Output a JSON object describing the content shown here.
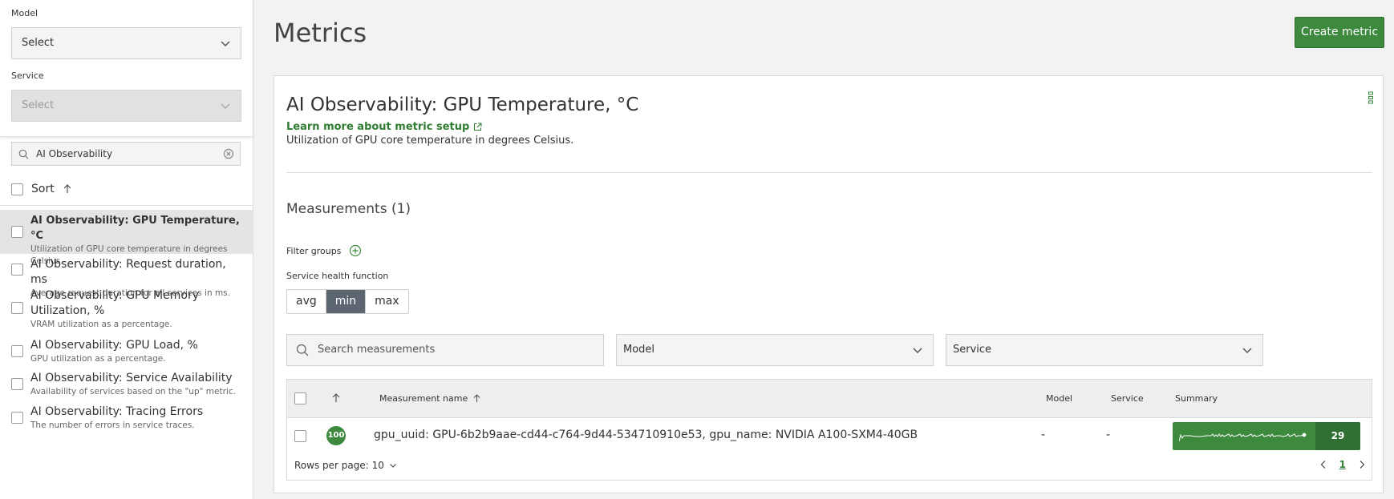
{
  "sidebar": {
    "model_label": "Model",
    "model_value": "Select",
    "service_label": "Service",
    "service_value": "Select",
    "search_value": "AI Observability",
    "sort_label": "Sort",
    "items": [
      {
        "title": "AI Observability: GPU Temperature, °C",
        "desc": "Utilization of GPU core temperature in degrees Celsius."
      },
      {
        "title": "AI Observability: Request duration, ms",
        "desc": "Average request duration for all services in ms."
      },
      {
        "title": "AI Observability: GPU Memory Utilization, %",
        "desc": "VRAM utilization as a percentage."
      },
      {
        "title": "AI Observability: GPU Load, %",
        "desc": "GPU utilization as a percentage."
      },
      {
        "title": "AI Observability: Service Availability",
        "desc": "Availability of services based on the \"up\" metric."
      },
      {
        "title": "AI Observability: Tracing Errors",
        "desc": "The number of errors in service traces."
      }
    ]
  },
  "main": {
    "title": "Metrics",
    "create_button": "Create metric",
    "card": {
      "title": "AI Observability: GPU Temperature, °C",
      "learn_more": "Learn more about metric setup",
      "description": "Utilization of GPU core temperature in degrees Celsius.",
      "measurements_title": "Measurements (1)",
      "filter_groups": "Filter groups",
      "health_function_label": "Service health function",
      "health_functions": [
        "avg",
        "min",
        "max"
      ],
      "health_function_selected": "min",
      "search_placeholder": "Search measurements",
      "model_filter": "Model",
      "service_filter": "Service",
      "table": {
        "headers": {
          "name": "Measurement name",
          "model": "Model",
          "service": "Service",
          "summary": "Summary"
        },
        "rows": [
          {
            "score": "100",
            "name": "gpu_uuid: GPU-6b2b9aae-cd44-c764-9d44-534710910e53, gpu_name: NVIDIA A100-SXM4-40GB",
            "model": "-",
            "service": "-",
            "summary_value": "29"
          }
        ],
        "rows_per_page": "Rows per page: 10",
        "page": "1"
      }
    }
  },
  "colors": {
    "accent_green": "#3d8a3f",
    "segment_active": "#5b6670"
  }
}
